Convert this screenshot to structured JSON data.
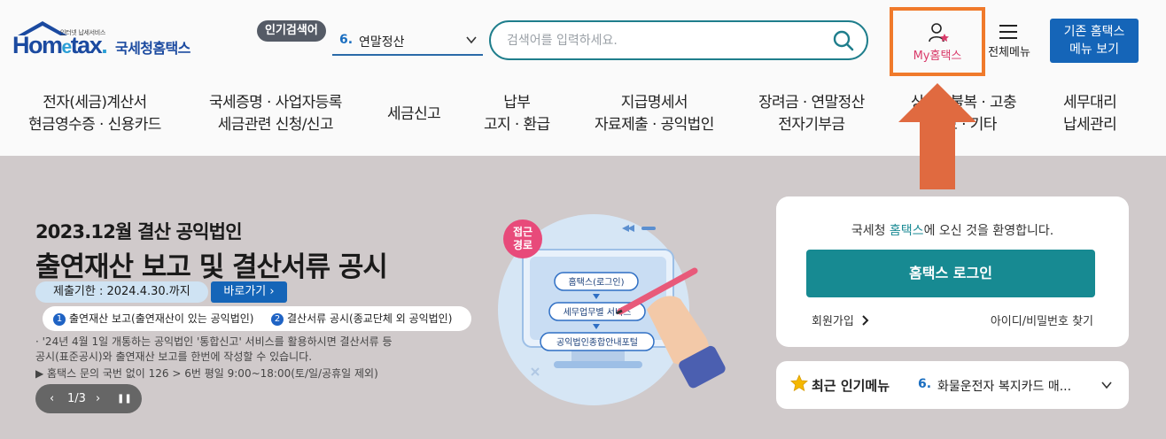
{
  "header": {
    "logo": {
      "tagline": "인터넷 납세서비스",
      "word": "Hometax",
      "korean": "국세청홈택스"
    },
    "popular": {
      "badge": "인기검색어",
      "rank": "6.",
      "term": "연말정산"
    },
    "search": {
      "placeholder": "검색어를 입력하세요."
    },
    "my_hometax": "My홈택스",
    "all_menu": "전체메뉴",
    "old_hometax": [
      "기존 홈택스",
      "메뉴 보기"
    ]
  },
  "gnb": [
    [
      "전자(세금)계산서",
      "현금영수증 · 신용카드"
    ],
    [
      "국세증명 · 사업자등록",
      "세금관련 신청/신고"
    ],
    [
      "세금신고"
    ],
    [
      "납부",
      "고지 · 환급"
    ],
    [
      "지급명세서",
      "자료제출 · 공익법인"
    ],
    [
      "장려금 · 연말정산",
      "전자기부금"
    ],
    [
      "상담 · 불복 · 고충",
      "제보 · 기타"
    ],
    [
      "세무대리",
      "납세관리"
    ]
  ],
  "banner": {
    "title1": "2023.12월 결산 공익법인",
    "title2": "출연재산 보고 및 결산서류 공시",
    "deadline": "제출기한 : 2024.4.30.까지",
    "shortcut": "바로가기 ›",
    "item1_num": "1",
    "item1": "출연재산 보고(출연재산이 있는 공익법인)",
    "item2_num": "2",
    "item2": "결산서류 공시(종교단체 외 공익법인)",
    "note1": "· '24년 4월 1일 개통하는 공익법인 '통합신고' 서비스를 활용하시면 결산서류 등",
    "note2": "  공시(표준공시)와 출연재산 보고를 한번에 작성할 수 있습니다.",
    "note3": "▶ 홈택스 문의 국번 없이 126 > 6번 평일 9:00~18:00(토/일/공휴일 제외)",
    "pager": {
      "prev": "‹",
      "page": "1/3",
      "next": "›",
      "pause": "❚❚"
    },
    "illustration": {
      "badge": [
        "접근",
        "경로"
      ],
      "steps": [
        "홈택스(로그인)",
        "세무업무별 서비스",
        "공익법인종합안내포털"
      ]
    }
  },
  "login": {
    "welcome_pre": "국세청 ",
    "welcome_hl": "홈택스",
    "welcome_post": "에 오신 것을 환영합니다.",
    "button": "홈택스 로그인",
    "join": "회원가입",
    "find": "아이디/비밀번호 찾기"
  },
  "popular_menu": {
    "title": "최근 인기메뉴",
    "rank": "6.",
    "value": "화물운전자 복지카드 매..."
  },
  "colors": {
    "brand": "#1b4aa0",
    "teal": "#178a92",
    "highlight_box": "#f07a2b",
    "arrow": "#e06a40"
  }
}
